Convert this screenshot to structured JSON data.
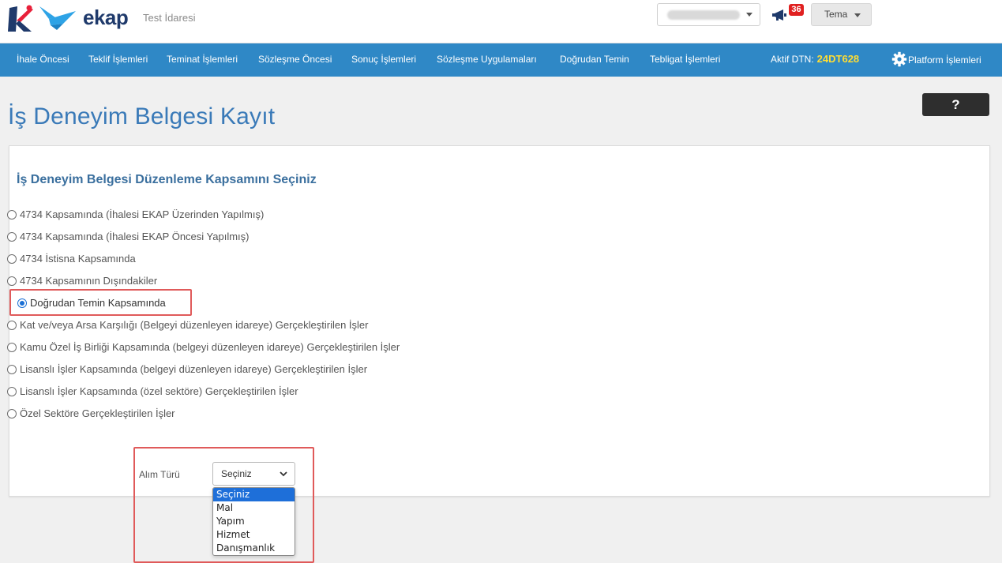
{
  "header": {
    "logo_text": "ekap",
    "org_name": "Test İdaresi",
    "notification_count": "36",
    "theme_label": "Tema",
    "colors": {
      "brand_navy": "#1f3a6b",
      "brand_red": "#e8203a",
      "brand_sky": "#2ea3e6"
    }
  },
  "nav": {
    "items": [
      "İhale Öncesi",
      "Teklif İşlemleri",
      "Teminat İşlemleri",
      "Sözleşme Öncesi",
      "Sonuç İşlemleri",
      "Sözleşme Uygulamaları",
      "Doğrudan Temin",
      "Tebligat İşlemleri"
    ],
    "aktif_label": "Aktif DTN:",
    "aktif_code": "24DT628",
    "platform_label": "Platform İşlemleri",
    "colors": {
      "bar": "#2f88c6",
      "code": "#ffdd33"
    }
  },
  "page": {
    "title": "İş Deneyim Belgesi Kayıt",
    "help_label": "?"
  },
  "form": {
    "section_title": "İş Deneyim Belgesi Düzenleme Kapsamını Seçiniz",
    "options": [
      "4734 Kapsamında (İhalesi EKAP Üzerinden Yapılmış)",
      "4734 Kapsamında (İhalesi EKAP Öncesi Yapılmış)",
      "4734 İstisna Kapsamında",
      "4734 Kapsamının Dışındakiler",
      "Doğrudan Temin Kapsamında",
      "Kat ve/veya Arsa Karşılığı (Belgeyi düzenleyen idareye) Gerçekleştirilen İşler",
      "Kamu Özel İş Birliği Kapsamında (belgeyi düzenleyen idareye) Gerçekleştirilen İşler",
      "Lisanslı İşler Kapsamında (belgeyi düzenleyen idareye) Gerçekleştirilen İşler",
      "Lisanslı İşler Kapsamında (özel sektöre) Gerçekleştirilen İşler",
      "Özel Sektöre Gerçekleştirilen İşler"
    ],
    "selected_option": "Doğrudan Temin Kapsamında",
    "alim_label": "Alım Türü",
    "alim_value": "Seçiniz",
    "alim_options": [
      "Seçiniz",
      "Mal",
      "Yapım",
      "Hizmet",
      "Danışmanlık"
    ],
    "highlight_color": "#e05a5a"
  }
}
